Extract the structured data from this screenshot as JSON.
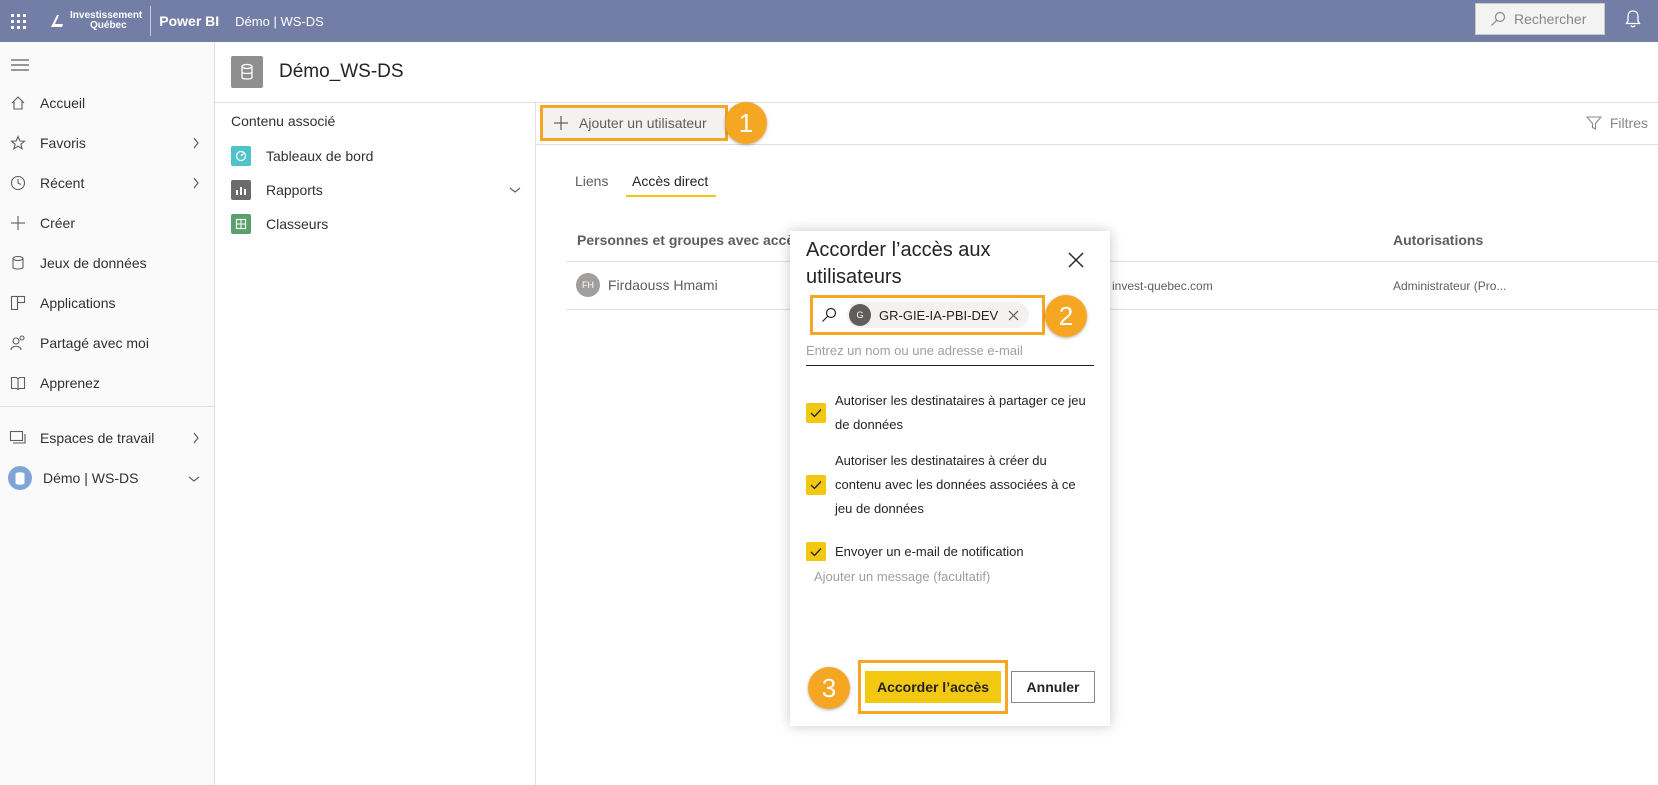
{
  "topbar": {
    "org_line1": "Investissement",
    "org_line2": "Québec",
    "product": "Power BI",
    "breadcrumb": "Démo | WS-DS",
    "search_placeholder": "Rechercher"
  },
  "leftnav": {
    "items": [
      {
        "label": "Accueil",
        "icon": "home-icon"
      },
      {
        "label": "Favoris",
        "icon": "star-icon"
      },
      {
        "label": "Récent",
        "icon": "clock-icon"
      },
      {
        "label": "Créer",
        "icon": "plus-icon"
      },
      {
        "label": "Jeux de données",
        "icon": "database-icon"
      },
      {
        "label": "Applications",
        "icon": "apps-icon"
      },
      {
        "label": "Partagé avec moi",
        "icon": "shared-icon"
      },
      {
        "label": "Apprenez",
        "icon": "book-icon"
      }
    ],
    "workspaces": "Espaces de travail",
    "current_workspace": "Démo | WS-DS"
  },
  "header": {
    "title": "Démo_WS-DS"
  },
  "related": {
    "heading": "Contenu associé",
    "items": [
      {
        "label": "Tableaux de bord",
        "color": "#4fc3c9"
      },
      {
        "label": "Rapports",
        "color": "#6b6b6b"
      },
      {
        "label": "Classeurs",
        "color": "#5aa06c"
      }
    ]
  },
  "toolbar": {
    "add_user": "Ajouter un utilisateur",
    "filters": "Filtres"
  },
  "tabs": {
    "links": "Liens",
    "direct": "Accès direct"
  },
  "table": {
    "col_people": "Personnes et groupes avec accès",
    "col_permissions": "Autorisations",
    "row": {
      "initials": "FH",
      "name": "Firdaouss Hmami",
      "email": "invest-quebec.com",
      "permission": "Administrateur (Pro..."
    }
  },
  "dialog": {
    "title": "Accorder l’accès aux utilisateurs",
    "chip_initial": "G",
    "chip_label": "GR-GIE-IA-PBI-DEV",
    "email_placeholder": "Entrez un nom ou une adresse e-mail",
    "opt_share": "Autoriser les destinataires à partager ce jeu de données",
    "opt_build": "Autoriser les destinataires à créer du contenu avec les données associées à ce jeu de données",
    "opt_notify": "Envoyer un e-mail de notification",
    "message_placeholder": "Ajouter un message (facultatif)",
    "grant": "Accorder l’accès",
    "cancel": "Annuler"
  },
  "steps": [
    "1",
    "2",
    "3"
  ],
  "colors": {
    "topbar": "#737ea7",
    "accent": "#f2c811",
    "highlight": "#f5a623"
  }
}
